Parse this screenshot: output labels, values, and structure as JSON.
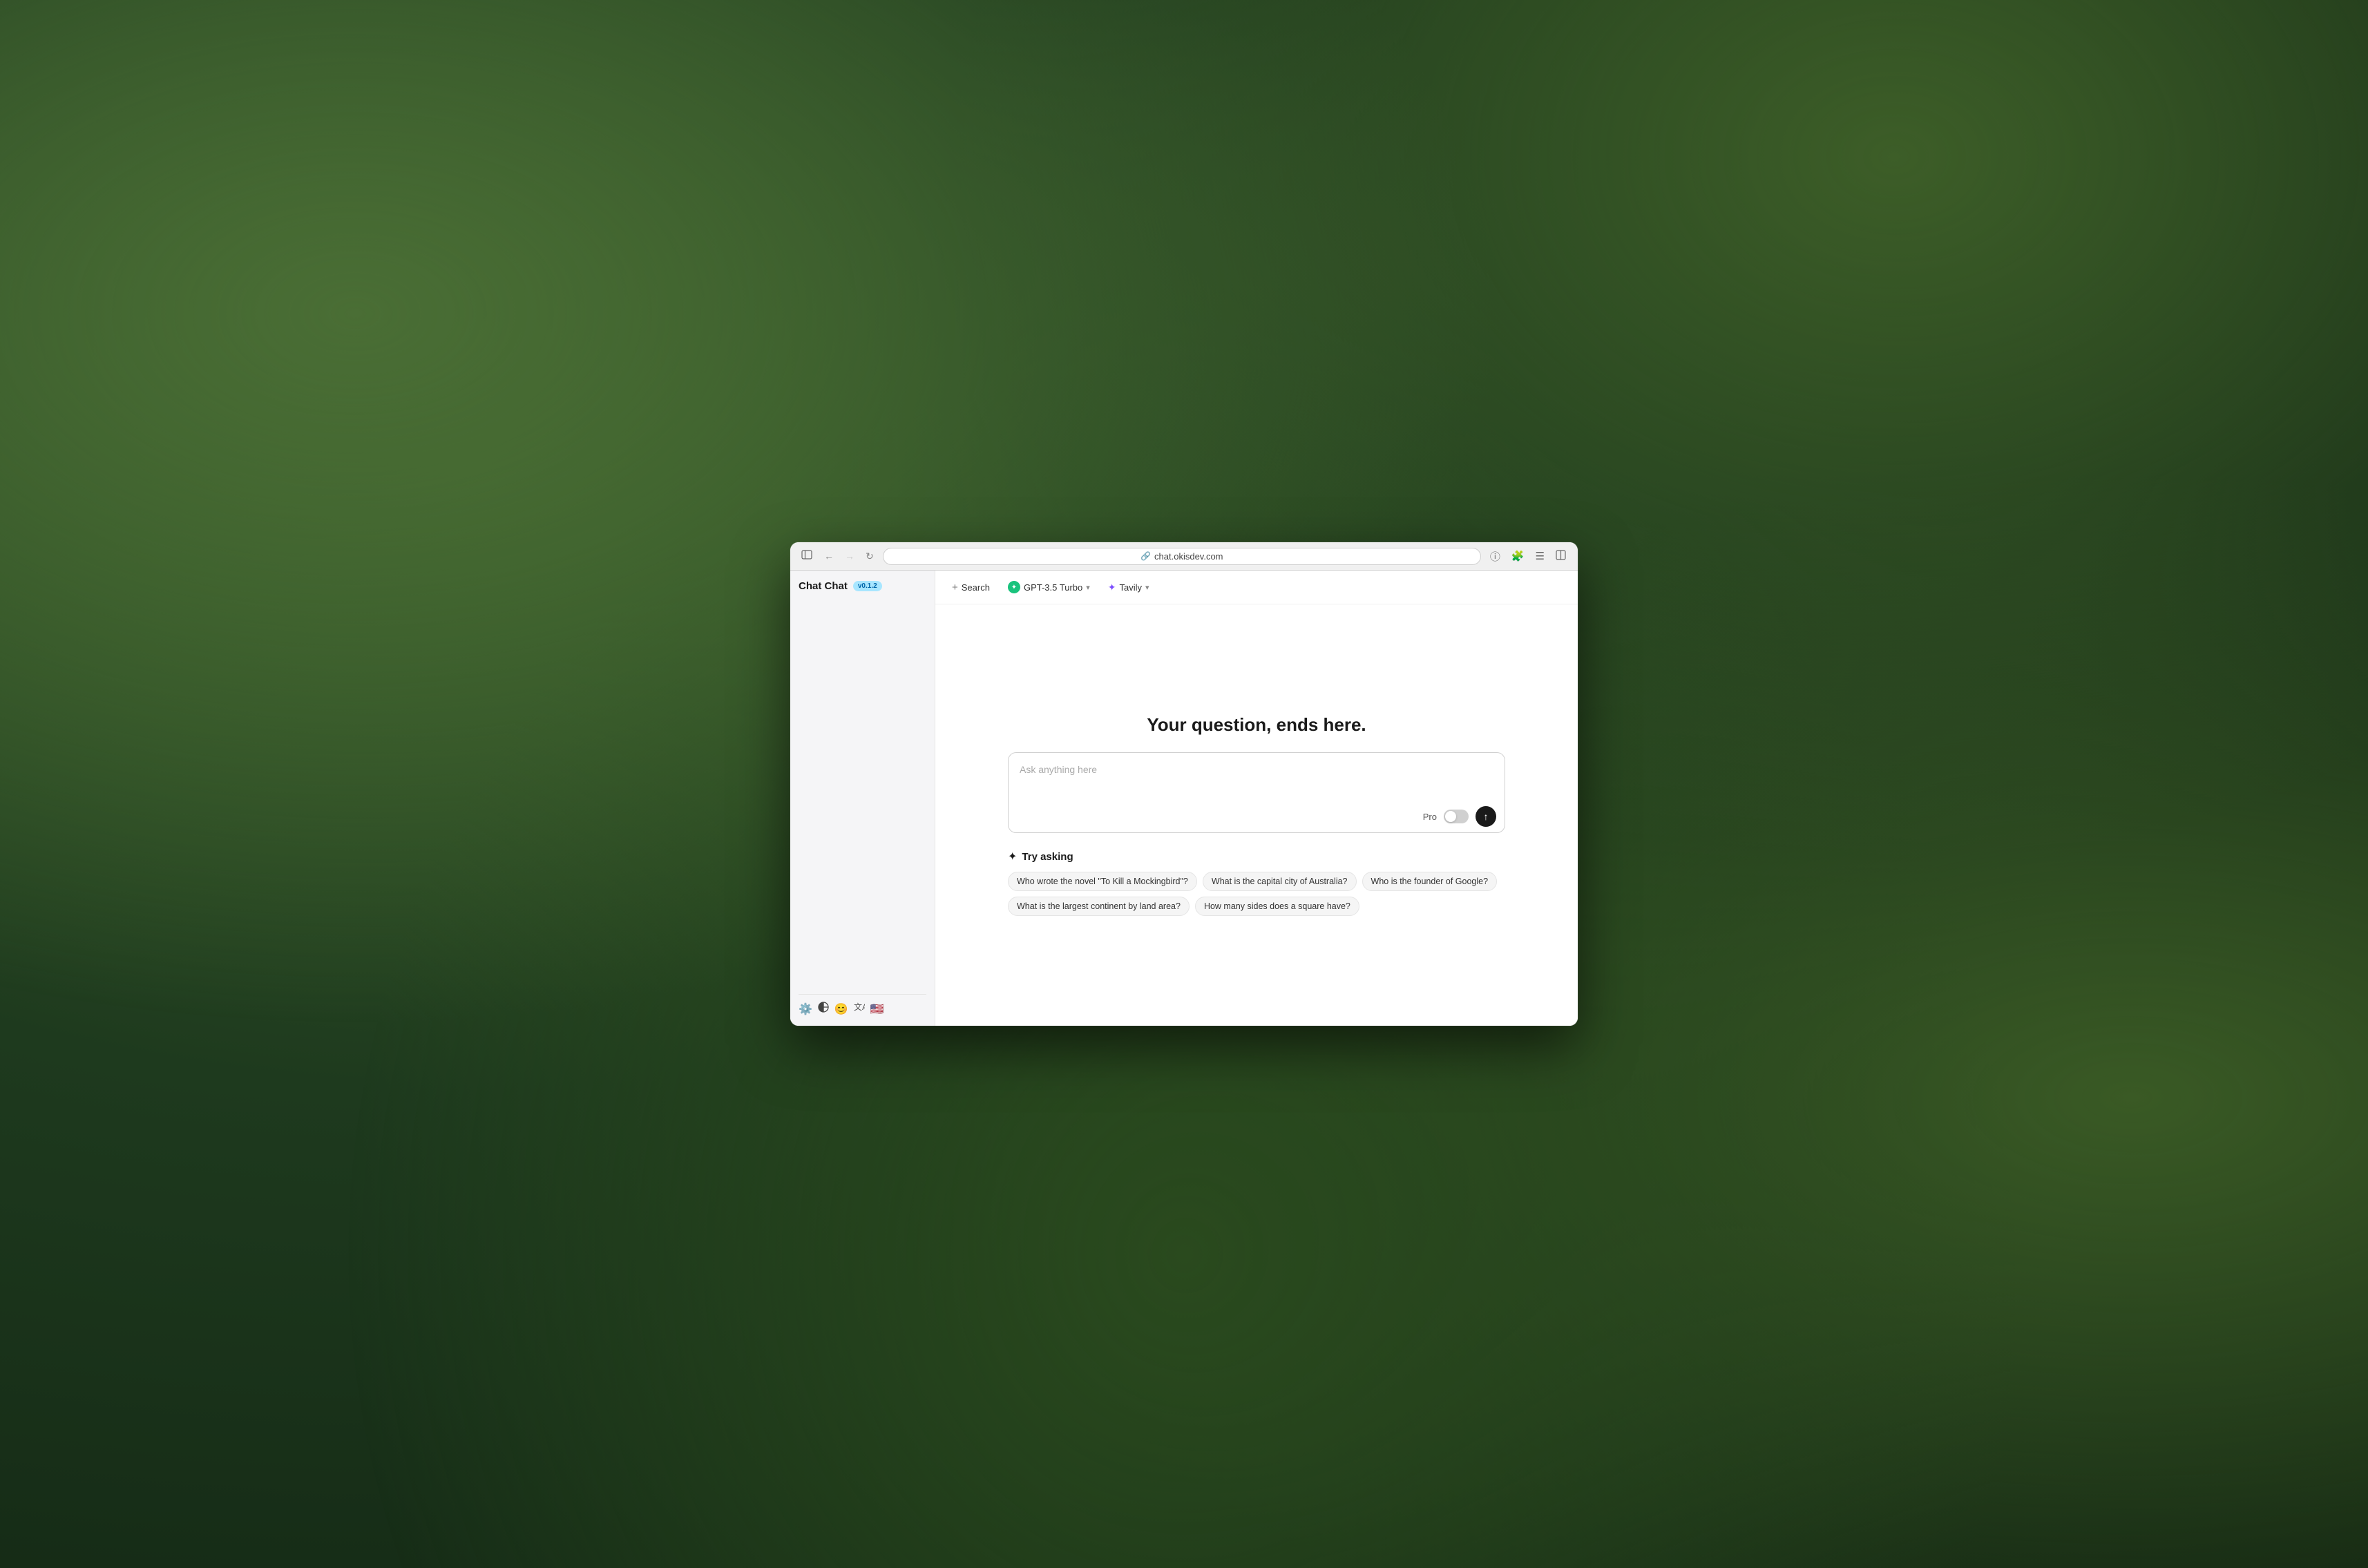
{
  "browser": {
    "url": "chat.okisdev.com",
    "back_disabled": false,
    "forward_disabled": true
  },
  "app": {
    "title": "Chat Chat",
    "version": "v0.1.2"
  },
  "topbar": {
    "search_label": "Search",
    "model_label": "GPT-3.5 Turbo",
    "tavily_label": "Tavily"
  },
  "main": {
    "heading": "Your question, ends here.",
    "input_placeholder": "Ask anything here",
    "pro_label": "Pro",
    "submit_label": "↑"
  },
  "try_asking": {
    "title": "Try asking",
    "suggestions": [
      "Who wrote the novel \"To Kill a Mockingbird\"?",
      "What is the capital city of Australia?",
      "Who is the founder of Google?",
      "What is the largest continent by land area?",
      "How many sides does a square have?"
    ]
  },
  "sidebar": {
    "footer_icons": [
      "settings",
      "theme",
      "emoji",
      "translate",
      "flag"
    ]
  }
}
